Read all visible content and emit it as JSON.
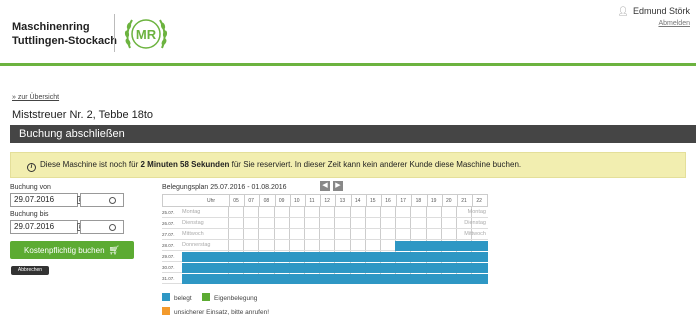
{
  "header": {
    "org_line1": "Maschinenring",
    "org_line2": "Tuttlingen-Stockach",
    "logo_text": "MR",
    "user_name": "Edmund Störk",
    "logout_label": "Abmelden"
  },
  "breadcrumb": {
    "back_label": "» zur Übersicht"
  },
  "machine_title": "Miststreuer Nr. 2, Tebbe 18to",
  "section_title": "Buchung abschließen",
  "notice": {
    "text_before": "Diese Maschine ist noch für ",
    "time_bold": "2 Minuten 58 Sekunden",
    "text_after": " für Sie reserviert. In dieser Zeit kann kein anderer Kunde diese Maschine buchen."
  },
  "form": {
    "from_label": "Buchung von",
    "from_value": "29.07.2016",
    "to_label": "Buchung bis",
    "to_value": "29.07.2016",
    "book_button": "Kostenpflichtig buchen",
    "cancel_button": "Abbrechen"
  },
  "schedule": {
    "title": "Belegungsplan 25.07.2016 - 01.08.2016",
    "uhr_label": "Uhr",
    "hours": [
      "05",
      "07",
      "08",
      "09",
      "10",
      "11",
      "12",
      "13",
      "14",
      "15",
      "16",
      "17",
      "18",
      "19",
      "20",
      "21",
      "22"
    ],
    "days": [
      {
        "date": "25.07.",
        "name": "Montag",
        "booked_from": null
      },
      {
        "date": "26.07.",
        "name": "Dienstag",
        "booked_from": null
      },
      {
        "date": "27.07.",
        "name": "Mittwoch",
        "booked_from": null
      },
      {
        "date": "28.07.",
        "name": "Donnerstag",
        "booked_from": "17"
      },
      {
        "date": "29.07.",
        "name": "",
        "booked_from": "all"
      },
      {
        "date": "30.07.",
        "name": "",
        "booked_from": "all"
      },
      {
        "date": "31.07.",
        "name": "",
        "booked_from": "all"
      }
    ],
    "prev_icon": "chevron-left-icon",
    "next_icon": "chevron-right-icon"
  },
  "legend": {
    "booked": "belegt",
    "own": "Eigenbelegung",
    "uncertain": "unsicherer Einsatz, bitte anrufen!"
  },
  "colors": {
    "accent_green": "#6cb33f",
    "booked_blue": "#2e97c4",
    "own_green": "#5cab32",
    "uncertain_orange": "#f39a2c",
    "section_bar": "#454545",
    "notice_bg": "#f2eeb0"
  }
}
